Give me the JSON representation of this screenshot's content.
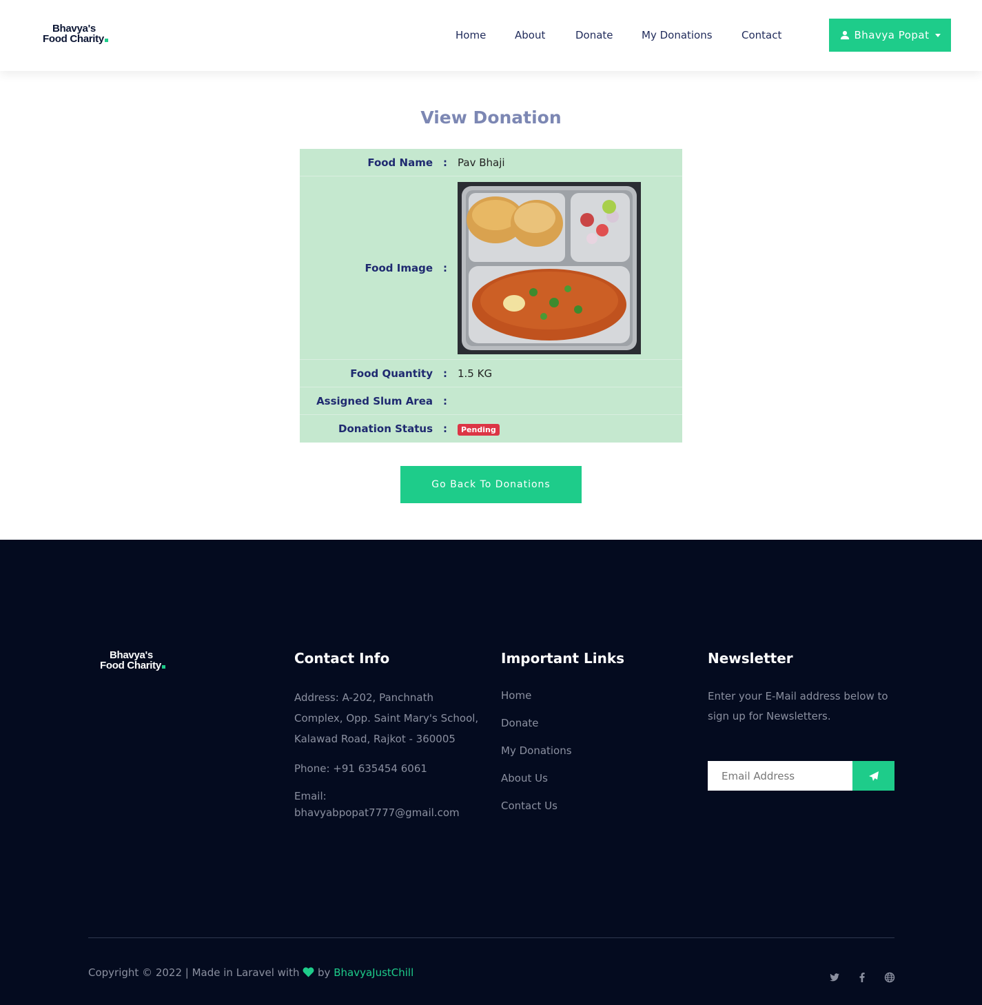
{
  "brand": {
    "logo_line1": "Bhavya's",
    "logo_line2": "Food Charity",
    "accent_color": "#1ecc8a"
  },
  "nav": {
    "items": [
      "Home",
      "About",
      "Donate",
      "My Donations",
      "Contact"
    ],
    "user_name": "Bhavya Popat",
    "user_icon": "user-icon"
  },
  "page": {
    "title": "View Donation",
    "fields": {
      "food_name": {
        "label": "Food Name",
        "value": "Pav Bhaji"
      },
      "food_image": {
        "label": "Food Image"
      },
      "food_quantity": {
        "label": "Food Quantity",
        "value": "1.5 KG"
      },
      "slum_area": {
        "label": "Assigned Slum Area",
        "value": ""
      },
      "status": {
        "label": "Donation Status",
        "value": "Pending",
        "color": "#dc3545"
      }
    },
    "separator": ":",
    "back_button": "Go Back To Donations"
  },
  "footer": {
    "contact": {
      "heading": "Contact Info",
      "address": "Address: A-202, Panchnath Complex, Opp. Saint Mary's School, Kalawad Road, Rajkot - 360005",
      "phone": "Phone: +91 635454 6061",
      "email_label": "Email:",
      "email": "bhavyabpopat7777@gmail.com"
    },
    "links": {
      "heading": "Important Links",
      "items": [
        "Home",
        "Donate",
        "My Donations",
        "About Us",
        "Contact Us"
      ]
    },
    "newsletter": {
      "heading": "Newsletter",
      "text": "Enter your E-Mail address below to sign up for Newsletters.",
      "placeholder": "Email Address",
      "send_icon": "paper-plane-icon"
    },
    "copyright_prefix": "Copyright © 2022 | Made in Laravel with",
    "copyright_by": "by",
    "author": "BhavyaJustChill",
    "social_icons": [
      "twitter-icon",
      "facebook-icon",
      "globe-icon"
    ]
  }
}
